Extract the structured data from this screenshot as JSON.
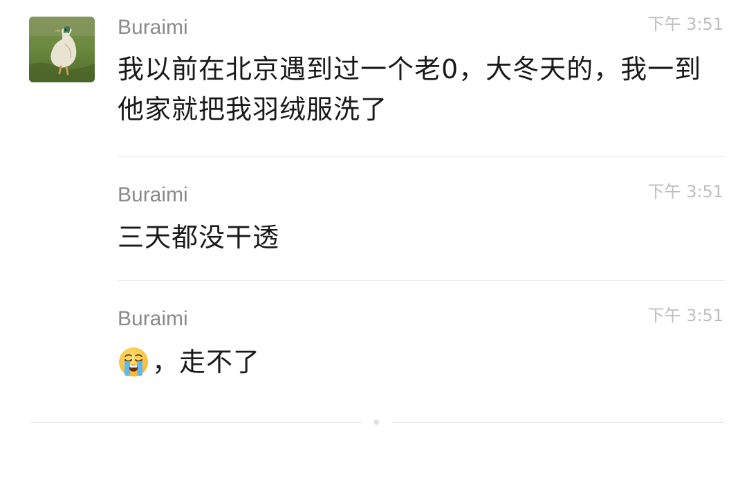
{
  "messages": [
    {
      "sender": "Buraimi",
      "time": "下午 3:51",
      "text": "我以前在北京遇到过一个老0，大冬天的，我一到他家就把我羽绒服洗了"
    },
    {
      "sender": "Buraimi",
      "time": "下午 3:51",
      "text": "三天都没干透"
    },
    {
      "sender": "Buraimi",
      "time": "下午 3:51",
      "emoji": "loudly-crying-face-icon",
      "text": "，走不了"
    }
  ],
  "colors": {
    "sender": "#8a8a8a",
    "time": "#bdbdbd",
    "text": "#1a1a1a",
    "divider": "#e6e6e6",
    "background": "#ffffff"
  },
  "icons": {
    "avatar": "duck-avatar",
    "emoji": "loudly-crying-face-icon"
  }
}
